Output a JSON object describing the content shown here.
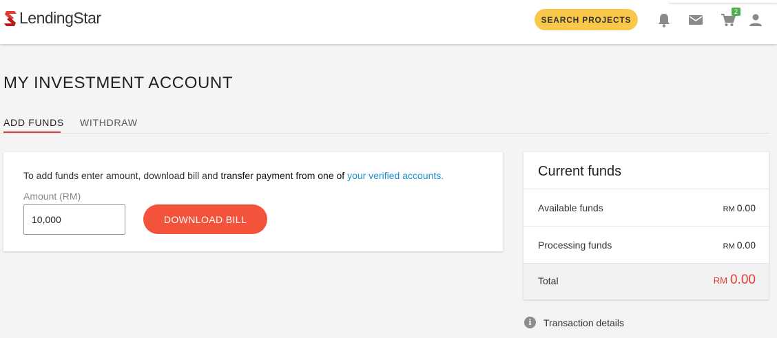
{
  "header": {
    "logo_text": "LendingStar",
    "search_button_label": "SEARCH PROJECTS",
    "cart_count": "2",
    "icons": [
      "bell-icon",
      "mail-icon",
      "cart-icon",
      "user-icon"
    ]
  },
  "page": {
    "title": "MY INVESTMENT ACCOUNT"
  },
  "tabs": [
    {
      "label": "ADD FUNDS",
      "active": true
    },
    {
      "label": "WITHDRAW",
      "active": false
    }
  ],
  "add_funds": {
    "instruction_part1": "To add funds enter amount, download bill and ",
    "instruction_bold": "transfer payment from one of ",
    "instruction_link": "your verified accounts.",
    "amount_label": "Amount (RM)",
    "amount_value": "10,000",
    "download_button_label": "DOWNLOAD BILL"
  },
  "current_funds": {
    "title": "Current funds",
    "rows": [
      {
        "label": "Available funds",
        "currency": "RM",
        "value": "0.00"
      },
      {
        "label": "Processing funds",
        "currency": "RM",
        "value": "0.00"
      },
      {
        "label": "Total",
        "currency": "RM",
        "value": "0.00"
      }
    ]
  },
  "transaction_details": {
    "label": "Transaction details"
  },
  "colors": {
    "accent_red": "#f4533b",
    "total_red": "#e53935",
    "search_yellow": "#f9c84a",
    "link_blue": "#1a8fd0",
    "badge_green": "#4caf50"
  }
}
